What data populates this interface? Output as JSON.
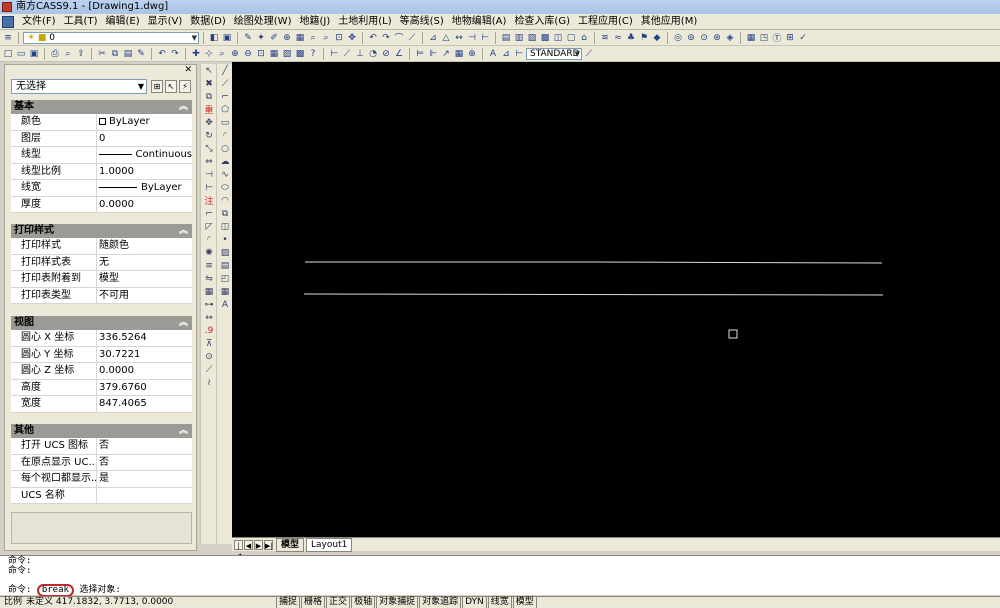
{
  "window": {
    "title": "南方CASS9.1 - [Drawing1.dwg]"
  },
  "menu": [
    "文件(F)",
    "工具(T)",
    "编辑(E)",
    "显示(V)",
    "数据(D)",
    "绘图处理(W)",
    "地籍(J)",
    "土地利用(L)",
    "等高线(S)",
    "地物编辑(A)",
    "检查入库(G)",
    "工程应用(C)",
    "其他应用(M)"
  ],
  "toolbar": {
    "layer_value": "0",
    "textstyle_value": "STANDARD"
  },
  "properties": {
    "selection": "无选择",
    "sections": [
      {
        "title": "基本",
        "rows": [
          {
            "key": "颜色",
            "value": "ByLayer",
            "kind": "color"
          },
          {
            "key": "图层",
            "value": "0"
          },
          {
            "key": "线型",
            "value": "Continuous",
            "kind": "line"
          },
          {
            "key": "线型比例",
            "value": "1.0000"
          },
          {
            "key": "线宽",
            "value": "ByLayer",
            "kind": "line"
          },
          {
            "key": "厚度",
            "value": "0.0000"
          }
        ]
      },
      {
        "title": "打印样式",
        "rows": [
          {
            "key": "打印样式",
            "value": "随颜色"
          },
          {
            "key": "打印样式表",
            "value": "无"
          },
          {
            "key": "打印表附着到",
            "value": "模型"
          },
          {
            "key": "打印表类型",
            "value": "不可用"
          }
        ]
      },
      {
        "title": "视图",
        "rows": [
          {
            "key": "圆心 X 坐标",
            "value": "336.5264"
          },
          {
            "key": "圆心 Y 坐标",
            "value": "30.7221"
          },
          {
            "key": "圆心 Z 坐标",
            "value": "0.0000"
          },
          {
            "key": "高度",
            "value": "379.6760"
          },
          {
            "key": "宽度",
            "value": "847.4065"
          }
        ]
      },
      {
        "title": "其他",
        "rows": [
          {
            "key": "打开 UCS 图标",
            "value": "否"
          },
          {
            "key": "在原点显示 UC...",
            "value": "否"
          },
          {
            "key": "每个视口都显示...",
            "value": "是"
          },
          {
            "key": "UCS 名称",
            "value": ""
          }
        ]
      }
    ]
  },
  "layout_tabs": [
    "模型",
    "Layout1"
  ],
  "command": {
    "line1": "命令:",
    "line2": "命令:",
    "prompt": "命令:",
    "entered": "break",
    "after": "选择对象:"
  },
  "status": {
    "label": "比例",
    "coords": "未定义  417.1832, 3.7713, 0.0000",
    "buttons": [
      "捕捉",
      "栅格",
      "正交",
      "极轴",
      "对象捕捉",
      "对象追踪",
      "DYN",
      "线宽",
      "模型"
    ]
  }
}
